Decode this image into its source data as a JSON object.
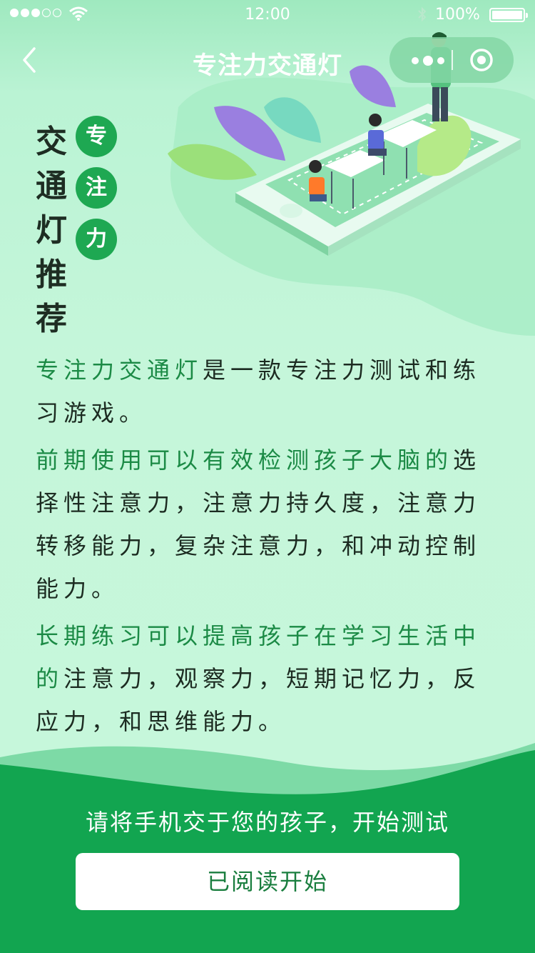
{
  "status_bar": {
    "time": "12:00",
    "battery": "100%",
    "signal_icon": "signal-dots-icon",
    "wifi_icon": "wifi-icon",
    "bluetooth_icon": "bluetooth-icon"
  },
  "navbar": {
    "title": "专注力交通灯",
    "back_icon": "chevron-left-icon",
    "more_icon": "more-dots-icon",
    "close_icon": "target-close-icon"
  },
  "hero": {
    "title_chars": [
      "交",
      "通",
      "灯",
      "推",
      "荐"
    ],
    "badge_chars": [
      "专",
      "注",
      "力"
    ]
  },
  "content": {
    "paragraphs": [
      {
        "lead": "专注力交通灯",
        "text": "是一款专注力测试和练习游戏。"
      },
      {
        "lead": "前期使用可以有效检测孩子大脑的",
        "text": "选择性注意力，注意力持久度，注意力转移能力，复杂注意力，和冲动控制能力。"
      },
      {
        "lead": "长期练习可以提高孩子在学习生活中的",
        "text": "注意力，观察力，短期记忆力，反应力，和思维能力。"
      }
    ]
  },
  "footer": {
    "prompt": "请将手机交于您的孩子，开始测试",
    "start_button": "已阅读开始"
  },
  "colors": {
    "primary_green": "#1ea852",
    "bottom_green": "#12a550",
    "background": "#c6f7db"
  }
}
